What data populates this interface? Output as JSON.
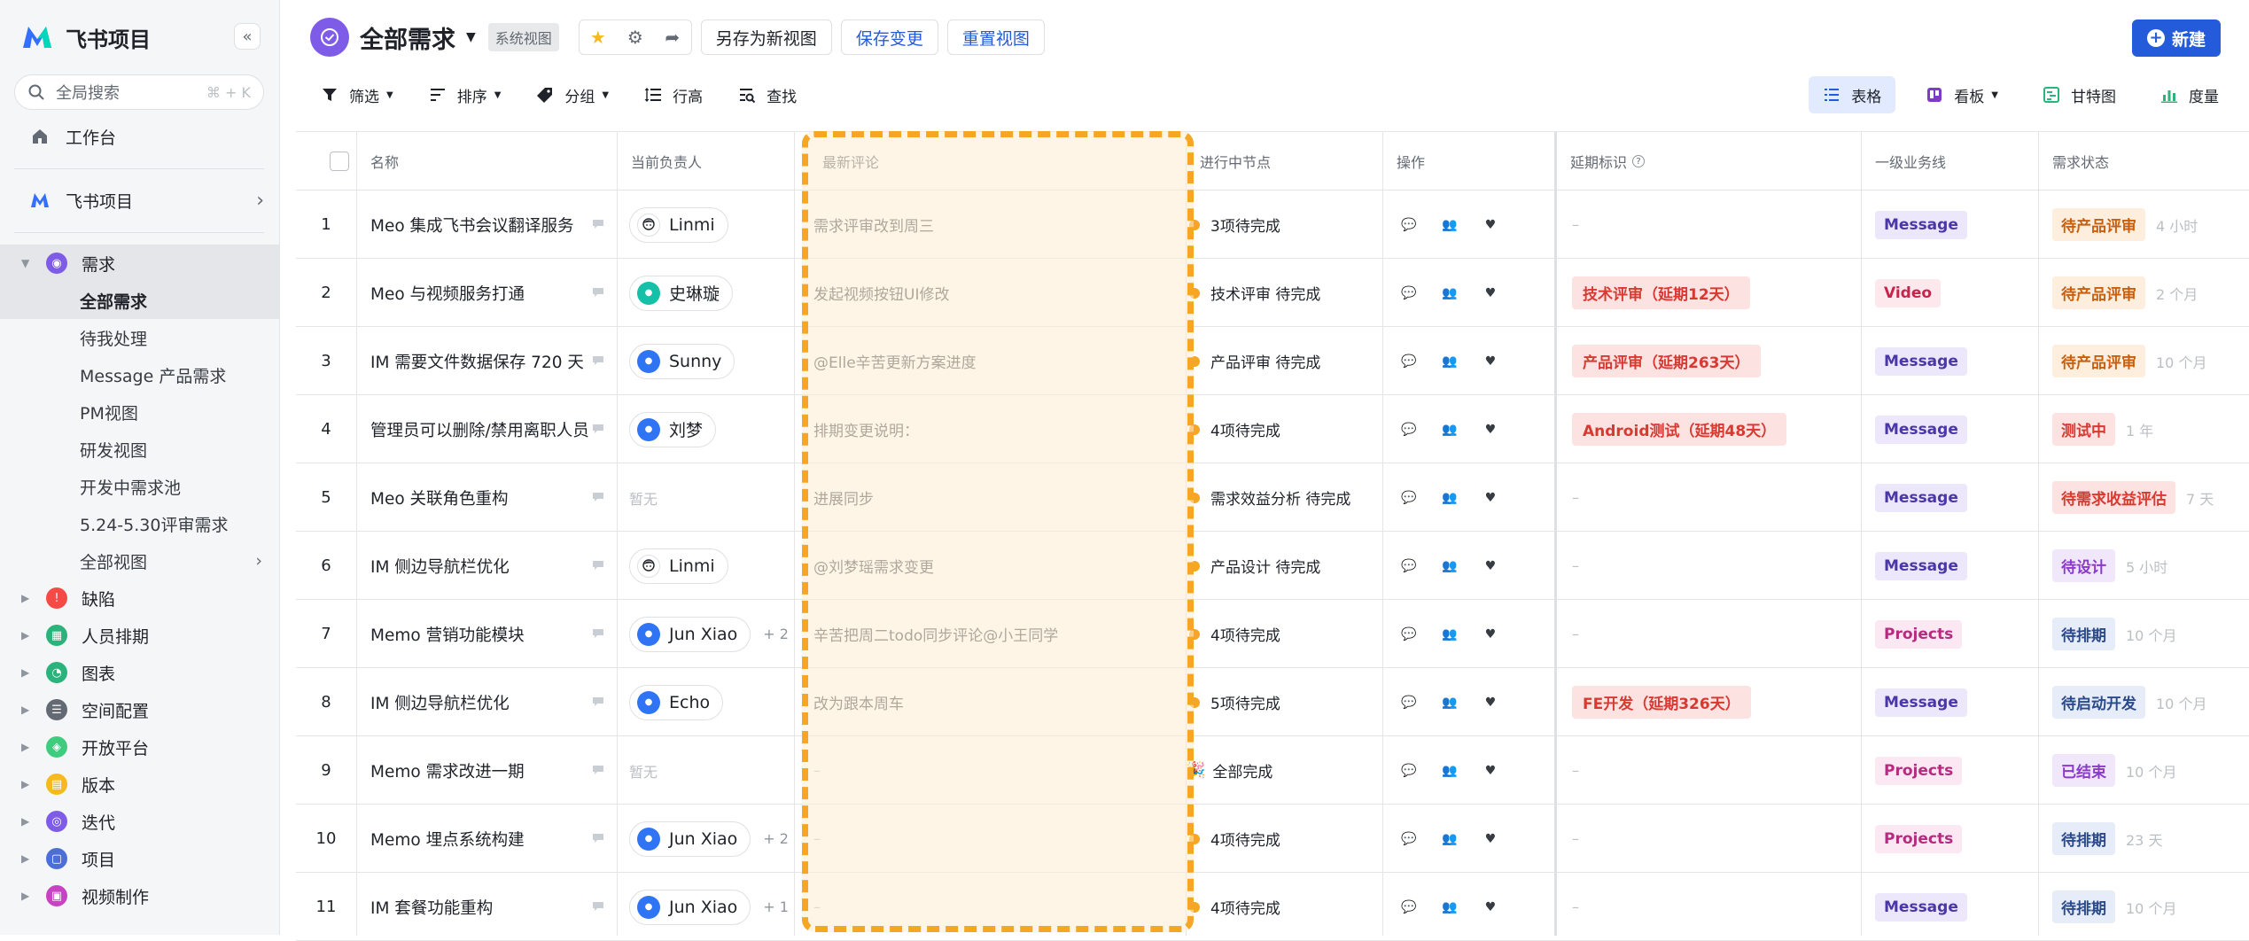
{
  "app": {
    "name": "飞书项目"
  },
  "sidebar": {
    "search_placeholder": "全局搜索",
    "search_shortcut": "⌘ + K",
    "home_label": "工作台",
    "project_label": "飞书项目",
    "tree": [
      {
        "label": "需求",
        "color": "#7f5ce8",
        "expanded": true
      },
      {
        "label": "缺陷",
        "color": "#f54a45"
      },
      {
        "label": "人员排期",
        "color": "#2ab37a"
      },
      {
        "label": "图表",
        "color": "#2ab37a"
      },
      {
        "label": "空间配置",
        "color": "#646a73"
      },
      {
        "label": "开放平台",
        "color": "#3fcc7e"
      },
      {
        "label": "版本",
        "color": "#f7ba1e"
      },
      {
        "label": "迭代",
        "color": "#7f5ce8"
      },
      {
        "label": "项目",
        "color": "#4c6ed8"
      },
      {
        "label": "视频制作",
        "color": "#c743c2"
      }
    ],
    "sub_items": [
      "全部需求",
      "待我处理",
      "Message 产品需求",
      "PM视图",
      "研发视图",
      "开发中需求池",
      "5.24-5.30评审需求",
      "全部视图"
    ]
  },
  "header": {
    "title": "全部需求",
    "badge": "系统视图",
    "save_as": "另存为新视图",
    "save_changes": "保存变更",
    "reset_view": "重置视图",
    "new_button": "新建"
  },
  "toolbar": {
    "filter": "筛选",
    "sort": "排序",
    "group": "分组",
    "row_height": "行高",
    "find": "查找"
  },
  "views": {
    "table": "表格",
    "kanban": "看板",
    "gantt": "甘特图",
    "metrics": "度量"
  },
  "table": {
    "columns": {
      "name": "名称",
      "owner": "当前负责人",
      "latest_comment": "最新评论",
      "node": "进行中节点",
      "ops": "操作",
      "delay": "延期标识",
      "biz": "一级业务线",
      "status": "需求状态"
    },
    "rows": [
      {
        "no": "1",
        "name": "Meo 集成飞书会议翻译服务",
        "owner": "Linmi",
        "owner_av": "face",
        "extra": "",
        "comment": "需求评审改到周三",
        "node": "3项待完成",
        "delay": "–",
        "biz": "Message",
        "status": "待产品评审",
        "status_kind": "st-orange",
        "time": "4 小时"
      },
      {
        "no": "2",
        "name": "Meo 与视频服务打通",
        "owner": "史琳璇",
        "owner_av": "teal",
        "extra": "",
        "comment": "发起视频按钮UI修改",
        "node": "技术评审 待完成",
        "delay": "技术评审（延期12天）",
        "biz": "Video",
        "status": "待产品评审",
        "status_kind": "st-orange",
        "time": "2 个月"
      },
      {
        "no": "3",
        "name": "IM 需要文件数据保存 720 天",
        "owner": "Sunny",
        "owner_av": "blue",
        "extra": "",
        "comment": "@Elle辛苦更新方案进度",
        "node": "产品评审 待完成",
        "delay": "产品评审（延期263天）",
        "biz": "Message",
        "status": "待产品评审",
        "status_kind": "st-orange",
        "time": "10 个月"
      },
      {
        "no": "4",
        "name": "管理员可以删除/禁用离职人员",
        "owner": "刘梦",
        "owner_av": "blue",
        "extra": "",
        "comment": "排期变更说明：",
        "node": "4项待完成",
        "delay": "Android测试（延期48天）",
        "biz": "Message",
        "status": "测试中",
        "status_kind": "st-red",
        "time": "1 年"
      },
      {
        "no": "5",
        "name": "Meo 关联角色重构",
        "owner": "",
        "owner_empty": "暂无",
        "extra": "",
        "comment": "进展同步",
        "node": "需求效益分析 待完成",
        "delay": "–",
        "biz": "Message",
        "status": "待需求收益评估",
        "status_kind": "st-red",
        "time": "7 天"
      },
      {
        "no": "6",
        "name": "IM 侧边导航栏优化",
        "owner": "Linmi",
        "owner_av": "face",
        "extra": "",
        "comment": "@刘梦瑶需求变更",
        "node": "产品设计 待完成",
        "delay": "–",
        "biz": "Message",
        "status": "待设计",
        "status_kind": "st-purple",
        "time": "5 小时"
      },
      {
        "no": "7",
        "name": "Memo 营销功能模块",
        "owner": "Jun Xiao",
        "owner_av": "blue",
        "extra": "+ 2",
        "comment": "辛苦把周二todo同步评论@小王同学",
        "node": "4项待完成",
        "delay": "–",
        "biz": "Projects",
        "status": "待排期",
        "status_kind": "st-blue",
        "time": "10 个月"
      },
      {
        "no": "8",
        "name": "IM 侧边导航栏优化",
        "owner": "Echo",
        "owner_av": "blue",
        "extra": "",
        "comment": "改为跟本周车",
        "node": "5项待完成",
        "delay": "FE开发（延期326天）",
        "biz": "Message",
        "status": "待启动开发",
        "status_kind": "st-blue",
        "time": "10 个月"
      },
      {
        "no": "9",
        "name": "Memo 需求改进一期",
        "owner": "",
        "owner_empty": "暂无",
        "extra": "",
        "comment": "–",
        "node": "全部完成",
        "node_done": true,
        "delay": "–",
        "biz": "Projects",
        "status": "已结束",
        "status_kind": "st-purple",
        "time": "10 个月"
      },
      {
        "no": "10",
        "name": "Memo 埋点系统构建",
        "owner": "Jun Xiao",
        "owner_av": "blue",
        "extra": "+ 2",
        "comment": "–",
        "node": "4项待完成",
        "delay": "–",
        "biz": "Projects",
        "status": "待排期",
        "status_kind": "st-blue",
        "time": "23 天"
      },
      {
        "no": "11",
        "name": "IM 套餐功能重构",
        "owner": "Jun Xiao",
        "owner_av": "blue",
        "extra": "+ 1",
        "comment": "–",
        "node": "4项待完成",
        "delay": "–",
        "biz": "Message",
        "status": "待排期",
        "status_kind": "st-blue",
        "time": "10 个月"
      }
    ]
  },
  "colors": {
    "accent": "#245bdb",
    "highlight": "#f5a623",
    "brand": "#7f5ce8"
  }
}
